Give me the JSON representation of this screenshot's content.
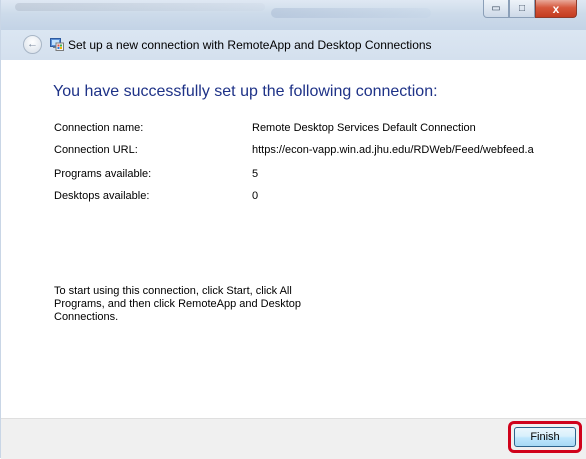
{
  "window": {
    "caption_buttons": {
      "minimize_glyph": "▭",
      "maximize_glyph": "□",
      "close_glyph": "x"
    }
  },
  "nav": {
    "back_glyph": "←",
    "title": "Set up a new connection with RemoteApp and Desktop Connections",
    "icon": "remoteapp-connection-icon"
  },
  "content": {
    "heading": "You have successfully set up the following connection:",
    "details": {
      "connection_name_label": "Connection name:",
      "connection_name_value": "Remote Desktop Services Default Connection",
      "connection_url_label": "Connection URL:",
      "connection_url_value": "https://econ-vapp.win.ad.jhu.edu/RDWeb/Feed/webfeed.a",
      "programs_label": "Programs available:",
      "programs_value": "5",
      "desktops_label": "Desktops available:",
      "desktops_value": "0"
    },
    "instructions": "To start using this connection, click Start, click All Programs, and then click RemoteApp and Desktop Connections."
  },
  "footer": {
    "finish_label": "Finish"
  },
  "colors": {
    "heading": "#1e3287",
    "highlight": "#d0021b",
    "close_button": "#c43b1f"
  }
}
